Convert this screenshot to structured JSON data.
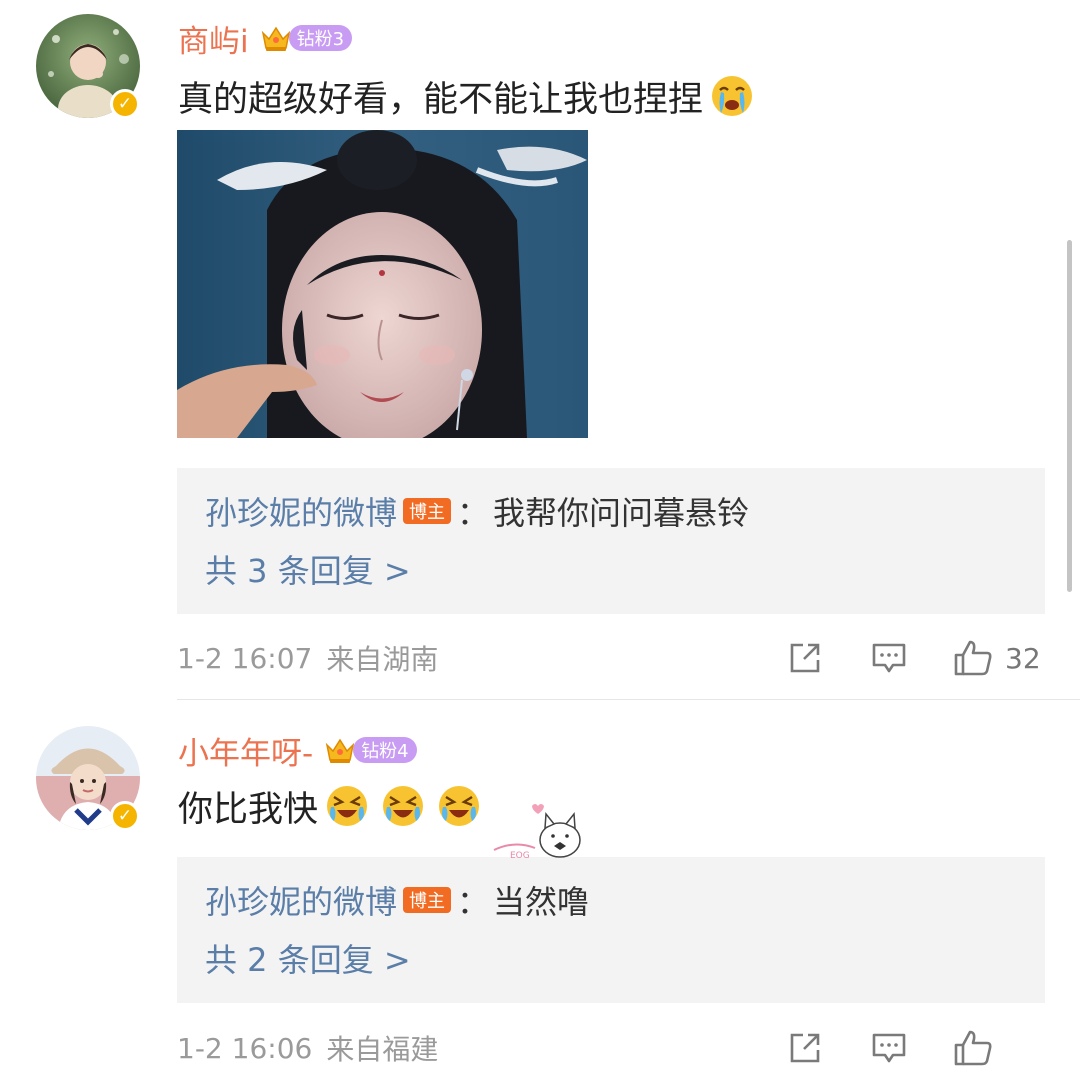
{
  "comments": [
    {
      "username": "商屿i",
      "fan_badge": "钻粉3",
      "text": "真的超级好看，能不能让我也捏捏",
      "emoji": "crying-face-icon",
      "reply": {
        "author": "孙珍妮的微博",
        "host_badge": "博主",
        "colon": "：",
        "content": "我帮你问问暮悬铃"
      },
      "more_replies": "共 3 条回复 >",
      "time": "1-2 16:07",
      "source": "来自湖南",
      "likes": "32"
    },
    {
      "username": "小年年呀-",
      "fan_badge": "钻粉4",
      "text": "你比我快",
      "emoji": "laughing-crying-face-icon",
      "reply": {
        "author": "孙珍妮的微博",
        "host_badge": "博主",
        "colon": "：",
        "content": "当然噜"
      },
      "more_replies": "共 2 条回复 >",
      "time": "1-2 16:06",
      "source": "来自福建",
      "likes": ""
    }
  ],
  "sticker_text": "EOG",
  "colors": {
    "username": "#eb7350",
    "reply_link": "#5a7ea8",
    "fan_pill": "#c89cf3",
    "host_badge": "#f26b22",
    "verified": "#f4b400",
    "meta": "#9a9a9a",
    "reply_bg": "#f3f3f3"
  },
  "icons": {
    "verified": "verified-badge-icon",
    "crown": "crown-icon",
    "forward": "forward-icon",
    "comment": "comment-icon",
    "like": "thumbs-up-icon"
  }
}
